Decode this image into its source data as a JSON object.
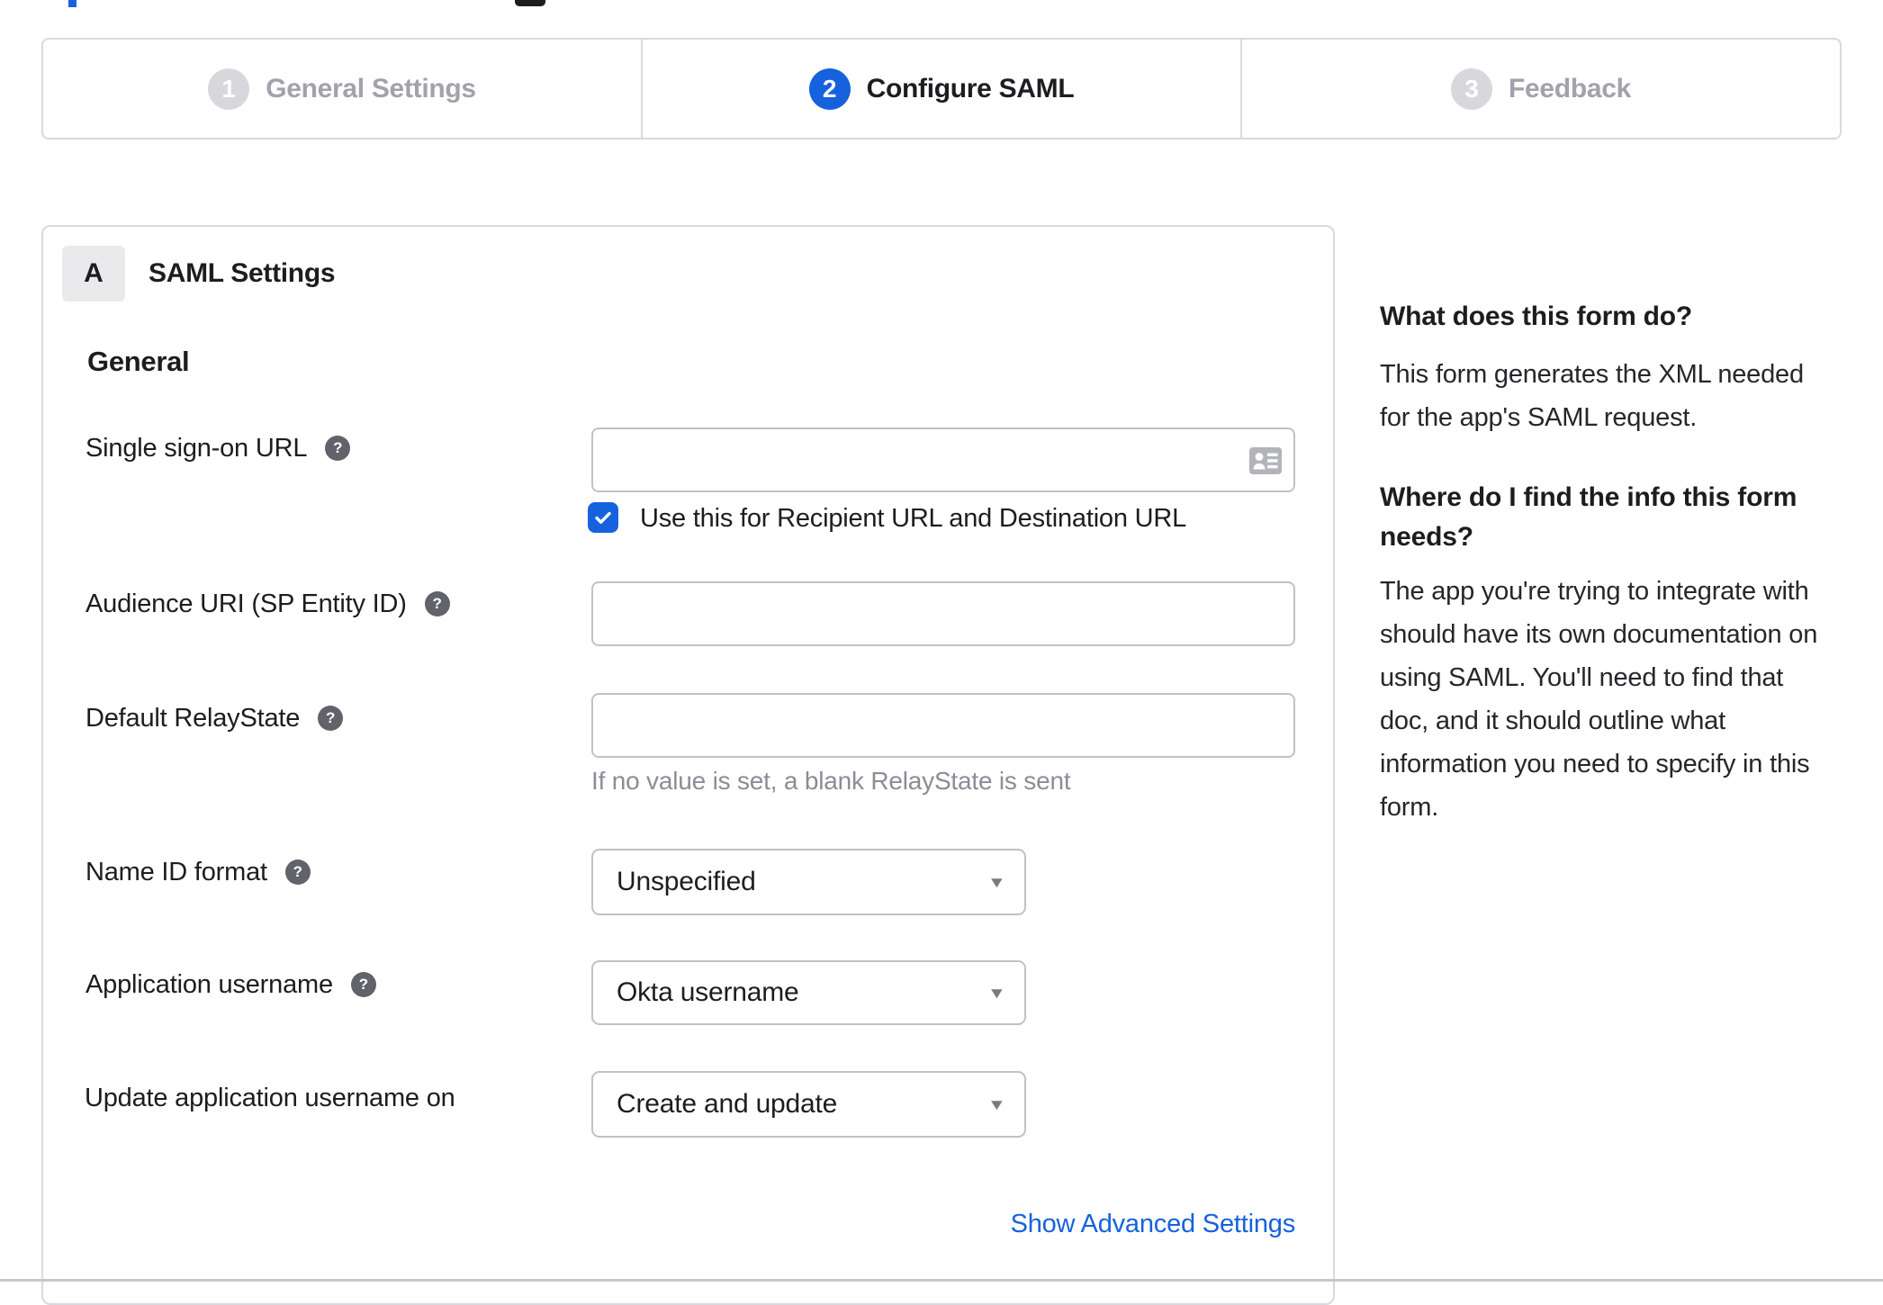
{
  "stepper": {
    "steps": [
      {
        "number": "1",
        "label": "General Settings",
        "state": "completed-inactive"
      },
      {
        "number": "2",
        "label": "Configure SAML",
        "state": "active"
      },
      {
        "number": "3",
        "label": "Feedback",
        "state": "upcoming"
      }
    ]
  },
  "panel": {
    "badge": "A",
    "title": "SAML Settings",
    "section_heading": "General",
    "fields": {
      "sso_url": {
        "label": "Single sign-on URL",
        "value": ""
      },
      "sso_use_for": {
        "label": "Use this for Recipient URL and Destination URL",
        "checked": true
      },
      "audience_uri": {
        "label": "Audience URI (SP Entity ID)",
        "value": ""
      },
      "default_relay_state": {
        "label": "Default RelayState",
        "value": "",
        "hint": "If no value is set, a blank RelayState is sent"
      },
      "name_id_format": {
        "label": "Name ID format",
        "value": "Unspecified"
      },
      "application_username": {
        "label": "Application username",
        "value": "Okta username"
      },
      "update_application_username_on": {
        "label": "Update application username on",
        "value": "Create and update"
      }
    },
    "advanced_link_label": "Show Advanced Settings"
  },
  "sidebar": {
    "sections": [
      {
        "heading": "What does this form do?",
        "body": "This form generates the XML needed\nfor the app's SAML request."
      },
      {
        "heading": "Where do I find the info this form\nneeds?",
        "body": "The app you're trying to integrate with\nshould have its own documentation on\nusing SAML. You'll need to find that\ndoc, and it should outline what\ninformation you need to specify in this\nform."
      }
    ]
  },
  "icons": {
    "help": "?",
    "caret_down": "▼",
    "checkmark": "✓",
    "contact_card": "contact-card"
  },
  "colors": {
    "accent_blue": "#1662dd",
    "text_dark": "#1d1d21",
    "hint_gray": "#8c8c96",
    "inactive_gray": "#a2a2aa",
    "card_border": "#d9d9de",
    "input_border": "#c1c1c8"
  }
}
